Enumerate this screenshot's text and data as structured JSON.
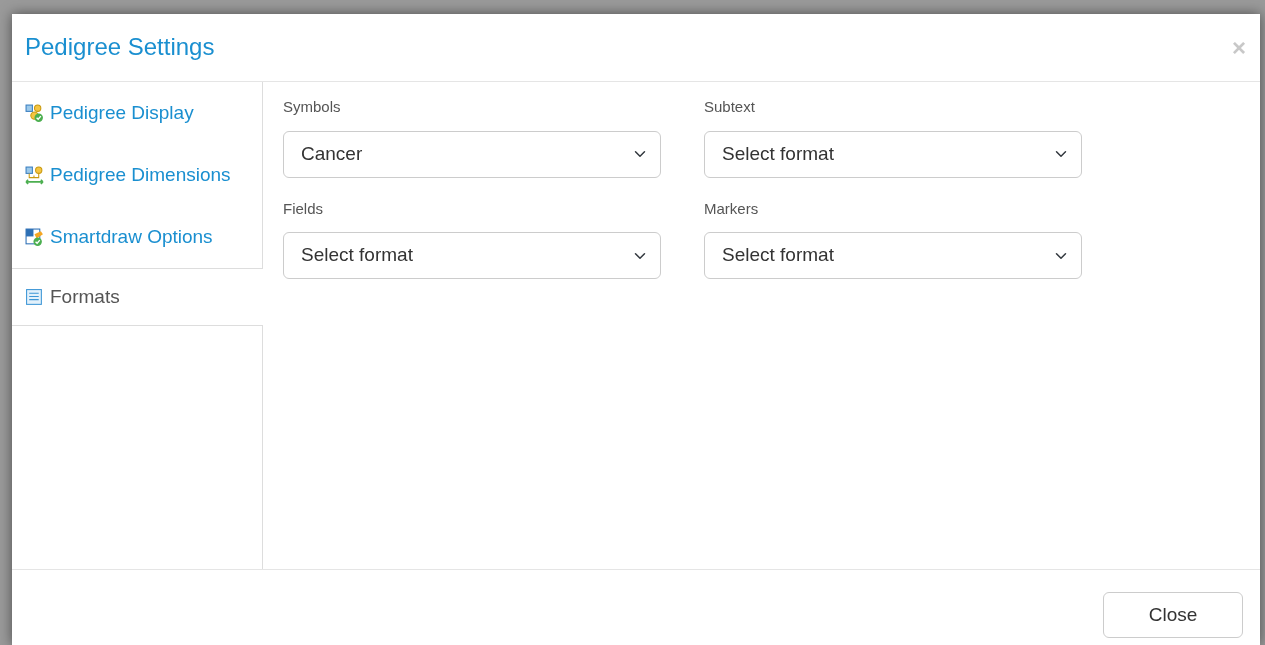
{
  "window": {
    "title": "Pedigree Settings",
    "close_glyph": "×"
  },
  "sidebar": {
    "items": [
      {
        "label": "Pedigree Display",
        "kind": "display",
        "selected": false
      },
      {
        "label": "Pedigree Dimensions",
        "kind": "dimensions",
        "selected": false
      },
      {
        "label": "Smartdraw Options",
        "kind": "options",
        "selected": false
      },
      {
        "label": "Formats",
        "kind": "formats",
        "selected": true
      }
    ]
  },
  "fields": [
    {
      "label": "Symbols",
      "value": "Cancer"
    },
    {
      "label": "Subtext",
      "placeholder": "Select format"
    },
    {
      "label": "Fields",
      "placeholder": "Select format"
    },
    {
      "label": "Markers",
      "placeholder": "Select format"
    }
  ],
  "footer": {
    "buttons": [
      "Close"
    ]
  }
}
